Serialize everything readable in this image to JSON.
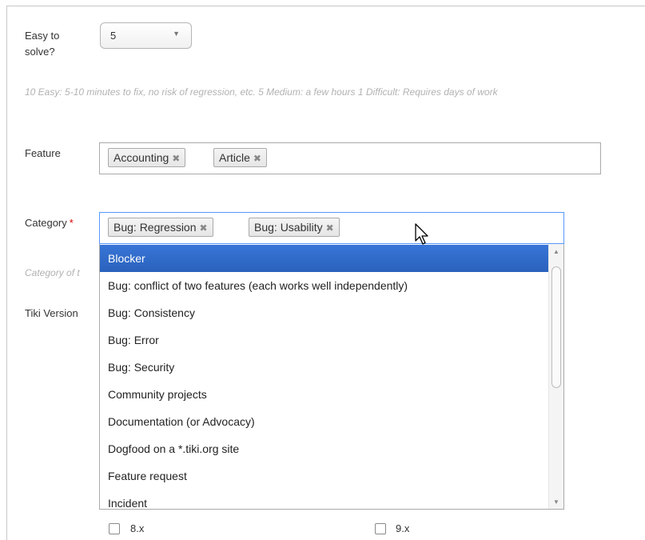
{
  "form": {
    "easy_label": "Easy to solve?",
    "easy_value": "5",
    "easy_help": "10 Easy: 5-10 minutes to fix, no risk of regression, etc. 5 Medium: a few hours 1 Difficult: Requires days of work",
    "feature_label": "Feature",
    "feature_tags": [
      "Accounting",
      "Article"
    ],
    "category_label": "Category",
    "required_mark": "*",
    "category_tags": [
      "Bug: Regression",
      "Bug: Usability"
    ],
    "category_help": "Category of t",
    "tiki_version_label": "Tiki Version",
    "remove_glyph": "✖"
  },
  "dropdown": {
    "options": [
      "Blocker",
      "Bug: conflict of two features (each works well independently)",
      "Bug: Consistency",
      "Bug: Error",
      "Bug: Security",
      "Community projects",
      "Documentation (or Advocacy)",
      "Dogfood on a *.tiki.org site",
      "Feature request",
      "Incident"
    ],
    "highlighted": "Blocker"
  },
  "versions": {
    "checkboxes": [
      "8.x",
      "9.x"
    ]
  }
}
